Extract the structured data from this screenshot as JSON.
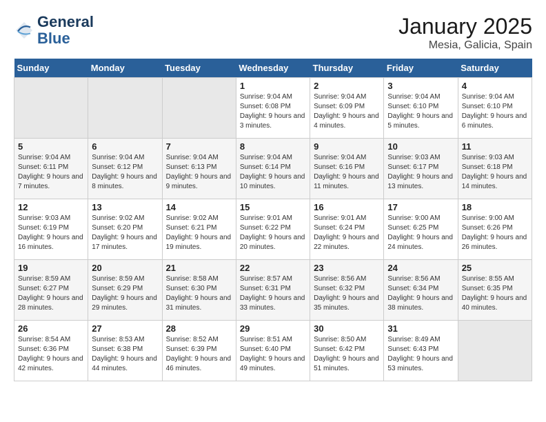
{
  "logo": {
    "line1": "General",
    "line2": "Blue"
  },
  "title": "January 2025",
  "location": "Mesia, Galicia, Spain",
  "weekdays": [
    "Sunday",
    "Monday",
    "Tuesday",
    "Wednesday",
    "Thursday",
    "Friday",
    "Saturday"
  ],
  "weeks": [
    [
      {
        "day": "",
        "info": ""
      },
      {
        "day": "",
        "info": ""
      },
      {
        "day": "",
        "info": ""
      },
      {
        "day": "1",
        "info": "Sunrise: 9:04 AM\nSunset: 6:08 PM\nDaylight: 9 hours and 3 minutes."
      },
      {
        "day": "2",
        "info": "Sunrise: 9:04 AM\nSunset: 6:09 PM\nDaylight: 9 hours and 4 minutes."
      },
      {
        "day": "3",
        "info": "Sunrise: 9:04 AM\nSunset: 6:10 PM\nDaylight: 9 hours and 5 minutes."
      },
      {
        "day": "4",
        "info": "Sunrise: 9:04 AM\nSunset: 6:10 PM\nDaylight: 9 hours and 6 minutes."
      }
    ],
    [
      {
        "day": "5",
        "info": "Sunrise: 9:04 AM\nSunset: 6:11 PM\nDaylight: 9 hours and 7 minutes."
      },
      {
        "day": "6",
        "info": "Sunrise: 9:04 AM\nSunset: 6:12 PM\nDaylight: 9 hours and 8 minutes."
      },
      {
        "day": "7",
        "info": "Sunrise: 9:04 AM\nSunset: 6:13 PM\nDaylight: 9 hours and 9 minutes."
      },
      {
        "day": "8",
        "info": "Sunrise: 9:04 AM\nSunset: 6:14 PM\nDaylight: 9 hours and 10 minutes."
      },
      {
        "day": "9",
        "info": "Sunrise: 9:04 AM\nSunset: 6:16 PM\nDaylight: 9 hours and 11 minutes."
      },
      {
        "day": "10",
        "info": "Sunrise: 9:03 AM\nSunset: 6:17 PM\nDaylight: 9 hours and 13 minutes."
      },
      {
        "day": "11",
        "info": "Sunrise: 9:03 AM\nSunset: 6:18 PM\nDaylight: 9 hours and 14 minutes."
      }
    ],
    [
      {
        "day": "12",
        "info": "Sunrise: 9:03 AM\nSunset: 6:19 PM\nDaylight: 9 hours and 16 minutes."
      },
      {
        "day": "13",
        "info": "Sunrise: 9:02 AM\nSunset: 6:20 PM\nDaylight: 9 hours and 17 minutes."
      },
      {
        "day": "14",
        "info": "Sunrise: 9:02 AM\nSunset: 6:21 PM\nDaylight: 9 hours and 19 minutes."
      },
      {
        "day": "15",
        "info": "Sunrise: 9:01 AM\nSunset: 6:22 PM\nDaylight: 9 hours and 20 minutes."
      },
      {
        "day": "16",
        "info": "Sunrise: 9:01 AM\nSunset: 6:24 PM\nDaylight: 9 hours and 22 minutes."
      },
      {
        "day": "17",
        "info": "Sunrise: 9:00 AM\nSunset: 6:25 PM\nDaylight: 9 hours and 24 minutes."
      },
      {
        "day": "18",
        "info": "Sunrise: 9:00 AM\nSunset: 6:26 PM\nDaylight: 9 hours and 26 minutes."
      }
    ],
    [
      {
        "day": "19",
        "info": "Sunrise: 8:59 AM\nSunset: 6:27 PM\nDaylight: 9 hours and 28 minutes."
      },
      {
        "day": "20",
        "info": "Sunrise: 8:59 AM\nSunset: 6:29 PM\nDaylight: 9 hours and 29 minutes."
      },
      {
        "day": "21",
        "info": "Sunrise: 8:58 AM\nSunset: 6:30 PM\nDaylight: 9 hours and 31 minutes."
      },
      {
        "day": "22",
        "info": "Sunrise: 8:57 AM\nSunset: 6:31 PM\nDaylight: 9 hours and 33 minutes."
      },
      {
        "day": "23",
        "info": "Sunrise: 8:56 AM\nSunset: 6:32 PM\nDaylight: 9 hours and 35 minutes."
      },
      {
        "day": "24",
        "info": "Sunrise: 8:56 AM\nSunset: 6:34 PM\nDaylight: 9 hours and 38 minutes."
      },
      {
        "day": "25",
        "info": "Sunrise: 8:55 AM\nSunset: 6:35 PM\nDaylight: 9 hours and 40 minutes."
      }
    ],
    [
      {
        "day": "26",
        "info": "Sunrise: 8:54 AM\nSunset: 6:36 PM\nDaylight: 9 hours and 42 minutes."
      },
      {
        "day": "27",
        "info": "Sunrise: 8:53 AM\nSunset: 6:38 PM\nDaylight: 9 hours and 44 minutes."
      },
      {
        "day": "28",
        "info": "Sunrise: 8:52 AM\nSunset: 6:39 PM\nDaylight: 9 hours and 46 minutes."
      },
      {
        "day": "29",
        "info": "Sunrise: 8:51 AM\nSunset: 6:40 PM\nDaylight: 9 hours and 49 minutes."
      },
      {
        "day": "30",
        "info": "Sunrise: 8:50 AM\nSunset: 6:42 PM\nDaylight: 9 hours and 51 minutes."
      },
      {
        "day": "31",
        "info": "Sunrise: 8:49 AM\nSunset: 6:43 PM\nDaylight: 9 hours and 53 minutes."
      },
      {
        "day": "",
        "info": ""
      }
    ]
  ]
}
